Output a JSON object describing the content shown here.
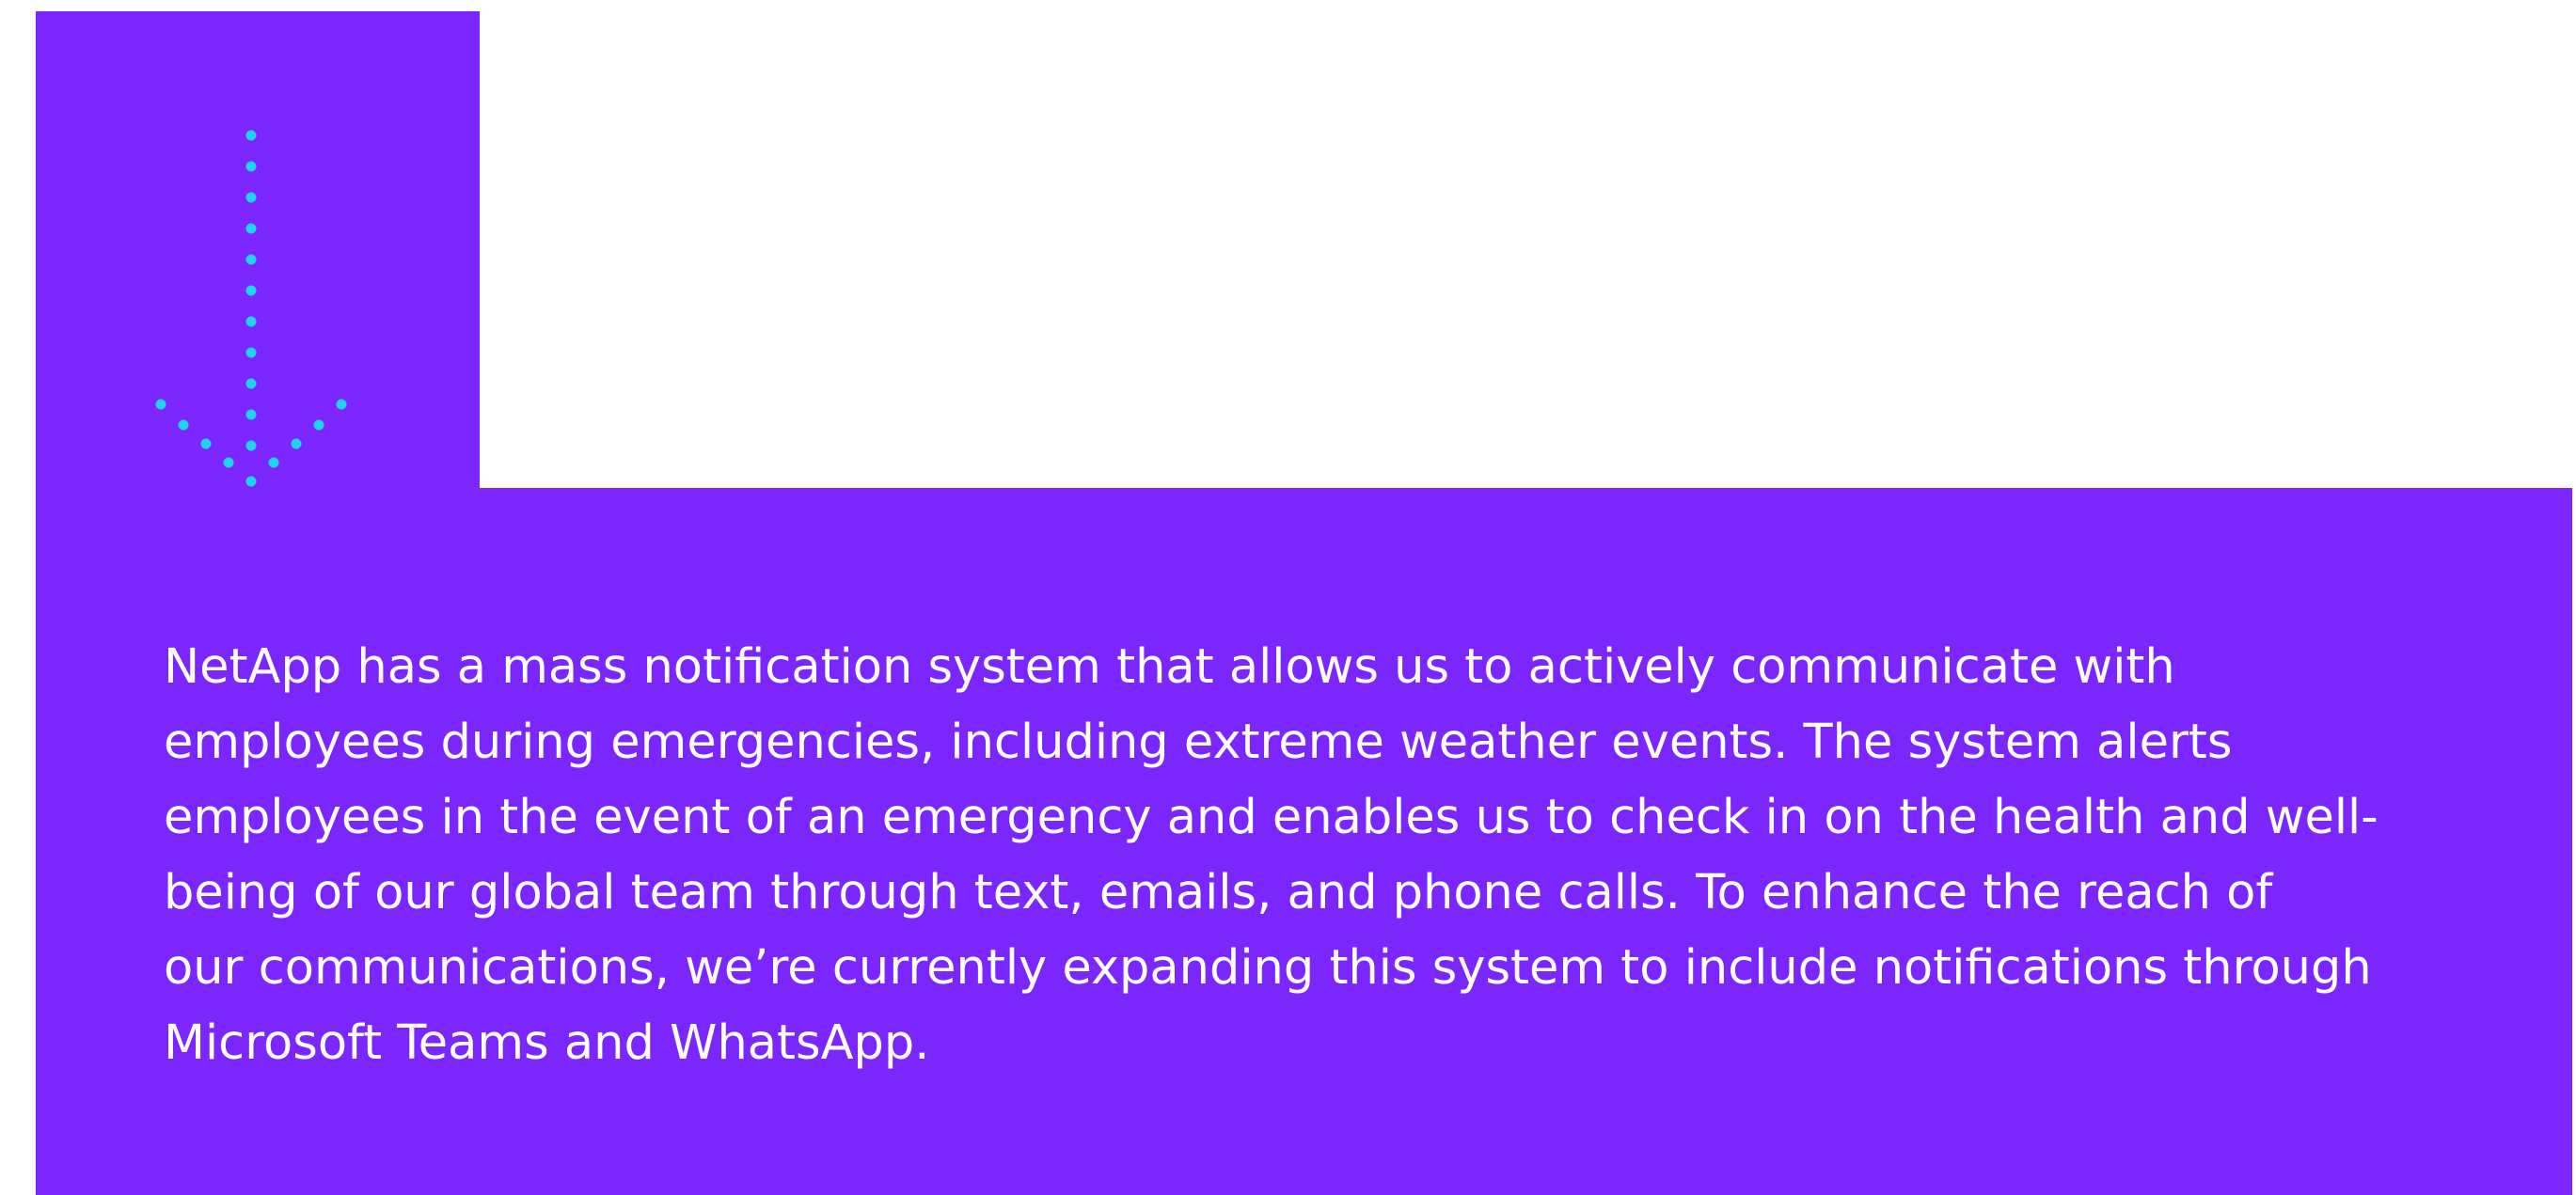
{
  "content": {
    "paragraph": "NetApp has a mass notification system that allows us to actively communicate with\nemployees during emergencies, including extreme weather events. The system alerts\nemployees in the event of an emergency and enables us to check in on the health and well-\nbeing of our global team through text, emails, and phone calls. To enhance the reach of\nour communications, we’re currently expanding this system to include notifications through\nMicrosoft Teams and WhatsApp."
  },
  "colors": {
    "panel": "#7b26fd",
    "arrow_dots": "#1ed4f2",
    "text": "#ffffff",
    "page_background": "#ffffff"
  },
  "icons": {
    "decorative": "dotted-down-arrow-icon"
  }
}
